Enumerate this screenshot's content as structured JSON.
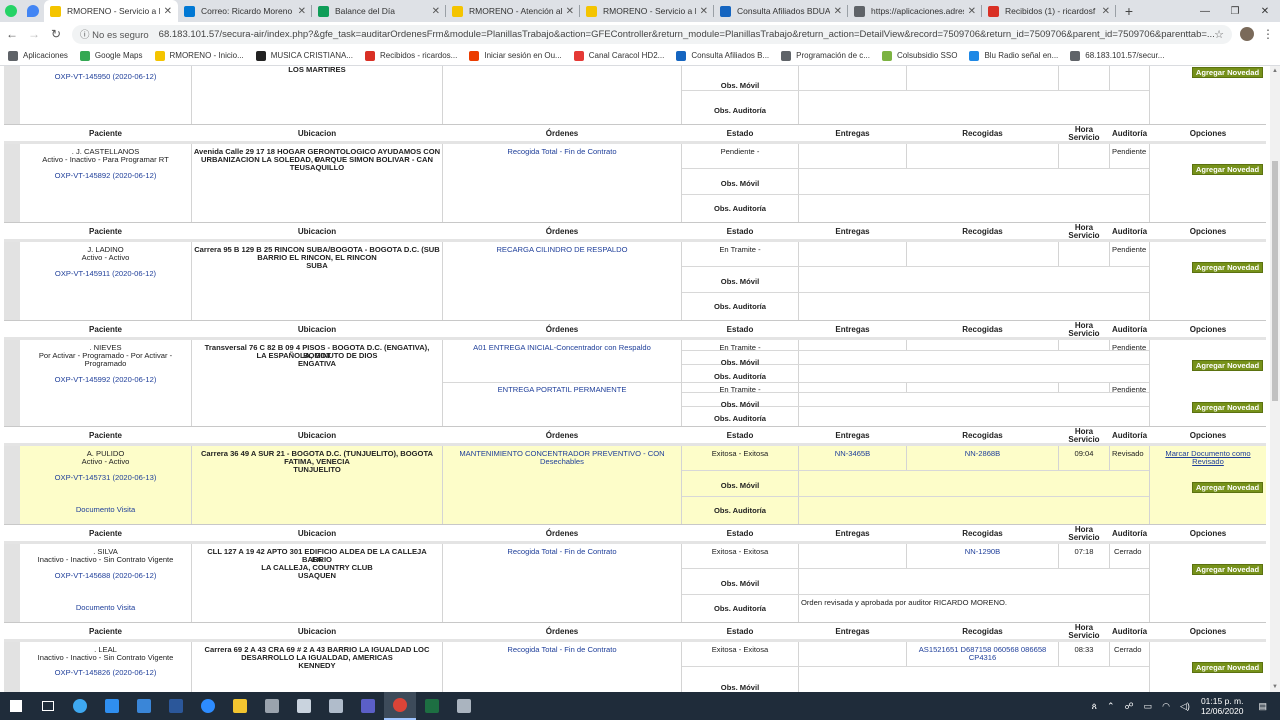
{
  "browser": {
    "pinned_tabs": [
      {
        "icon": "whatsapp-icon",
        "color": "#25d366"
      },
      {
        "icon": "maps-pin-icon",
        "color": "#4285f4"
      }
    ],
    "tabs": [
      {
        "title": "RMORENO - Servicio a D",
        "icon": "rmoreno-favicon",
        "color": "#f4c400",
        "active": true
      },
      {
        "title": "Correo: Ricardo Moreno",
        "icon": "outlook-favicon",
        "color": "#0078d4"
      },
      {
        "title": "Balance del Día",
        "icon": "sheets-favicon",
        "color": "#0f9d58"
      },
      {
        "title": "RMORENO - Atención al",
        "icon": "rmoreno-favicon",
        "color": "#f4c400"
      },
      {
        "title": "RMORENO - Servicio a D",
        "icon": "rmoreno-favicon",
        "color": "#f4c400"
      },
      {
        "title": "Consulta Afiliados BDUA",
        "icon": "triangle-favicon",
        "color": "#1565c0"
      },
      {
        "title": "https://aplicaciones.adres",
        "icon": "globe-favicon",
        "color": "#5f6368"
      },
      {
        "title": "Recibidos (1) - ricardosf",
        "icon": "gmail-favicon",
        "color": "#d93025"
      }
    ],
    "new_tab": "+",
    "window_controls": {
      "minimize": "—",
      "restore": "❐",
      "close": "✕"
    },
    "security_label": "No es seguro",
    "url": "68.183.101.57/secura-air/index.php?&gfe_task=auditarOrdenesFrm&module=PlanillasTrabajo&action=GFEController&return_module=PlanillasTrabajo&return_action=DetailView&record=7509706&return_id=7509706&parent_id=7509706&parenttab=...",
    "bookmarks": [
      {
        "label": "Aplicaciones",
        "icon": "apps-grid-icon",
        "color": "#5f6368"
      },
      {
        "label": "Google Maps",
        "icon": "maps-pin-icon",
        "color": "#34a853"
      },
      {
        "label": "RMORENO - Inicio...",
        "icon": "rmoreno-favicon",
        "color": "#f4c400"
      },
      {
        "label": "MUSICA CRISTIANA...",
        "icon": "music-favicon",
        "color": "#222222"
      },
      {
        "label": "Recibidos - ricardos...",
        "icon": "gmail-favicon",
        "color": "#d93025"
      },
      {
        "label": "Iniciar sesión en Ou...",
        "icon": "office-favicon",
        "color": "#eb3c00"
      },
      {
        "label": "Canal Caracol HD2...",
        "icon": "caracol-favicon",
        "color": "#e53935"
      },
      {
        "label": "Consulta Afiliados B...",
        "icon": "triangle-favicon",
        "color": "#1565c0"
      },
      {
        "label": "Programación de c...",
        "icon": "link-favicon",
        "color": "#5f6368"
      },
      {
        "label": "Colsubsidio SSO",
        "icon": "colsubsidio-favicon",
        "color": "#7cb342"
      },
      {
        "label": "Blu Radio señal en...",
        "icon": "blu-favicon",
        "color": "#1e88e5"
      },
      {
        "label": "68.183.101.57/secur...",
        "icon": "globe-favicon",
        "color": "#5f6368"
      }
    ]
  },
  "table": {
    "headers": {
      "paciente": "Paciente",
      "ubicacion": "Ubicacion",
      "ordenes": "Órdenes",
      "estado": "Estado",
      "entregas": "Entregas",
      "recogidas": "Recogidas",
      "hora_l1": "Hora",
      "hora_l2": "Servicio",
      "auditoria": "Auditoría",
      "opciones": "Opciones"
    },
    "labels": {
      "obs_movil": "Obs. Móvil",
      "obs_auditoria": "Obs. Auditoría",
      "agregar": "Agregar Novedad",
      "documento_visita": "Documento Visita",
      "marcar_l1": "Marcar Documento como",
      "marcar_l2": "Revisado"
    },
    "top": {
      "order_id": "OXP-VT-145950 (2020-06-12)",
      "ubic": "LOS MARTIRES"
    },
    "records": [
      {
        "name": ". J. CASTELLANOS",
        "status": "Activo - Inactivo - Para Programar RT",
        "order_id": "OXP-VT-145892 (2020-06-12)",
        "ubic1": "Avenida Calle 29 17 18 HOGAR GERONTOLOGICO AYUDAMOS CON C",
        "ubic2": "URBANIZACION LA SOLEDAD, PARQUE SIMON BOLIVAR - CAN",
        "ubic3": "TEUSAQUILLO",
        "orden": "Recogida Total - Fin de Contrato",
        "estado": "Pendiente -",
        "auditoria": "Pendiente"
      },
      {
        "name": "J. LADINO",
        "status": "Activo - Activo",
        "order_id": "OXP-VT-145911 (2020-06-12)",
        "ubic1": "Carrera 95 B 129 B 25 RINCON SUBA/BOGOTA - BOGOTA D.C. (SUB",
        "ubic2": "BARRIO EL RINCON, EL RINCON",
        "ubic3": "SUBA",
        "orden": "RECARGA CILINDRO DE RESPALDO",
        "estado": "En Tramite -",
        "auditoria": "Pendiente"
      },
      {
        "name": ". NIEVES",
        "status1": "Por Activar - Programado - Por Activar -",
        "status2": "Programado",
        "order_id": "OXP-VT-145992 (2020-06-12)",
        "ubic1": "Transversal 76 C 82 B 09 4 PISOS - BOGOTA D.C. (ENGATIVA), BOGOT",
        "ubic2": "LA ESPAÑOLA, MINUTO DE DIOS",
        "ubic3": "ENGATIVA",
        "orden_a": "A01 ENTREGA INICIAL-Concentrador con Respaldo",
        "estado_a": "En Tramite -",
        "auditoria_a": "Pendiente",
        "orden_b": "ENTREGA PORTATIL PERMANENTE",
        "estado_b": "En Tramite -",
        "auditoria_b": "Pendiente"
      },
      {
        "name": "A. PULIDO",
        "status": "Activo - Activo",
        "order_id": "OXP-VT-145731 (2020-06-13)",
        "ubic1": "Carrera 36 49 A SUR 21 - BOGOTA D.C. (TUNJUELITO), BOGOTA",
        "ubic2": "FATIMA, VENECIA",
        "ubic3": "TUNJUELITO",
        "orden1": "MANTENIMIENTO CONCENTRADOR PREVENTIVO - CON",
        "orden2": "Desechables",
        "estado": "Exitosa - Exitosa",
        "entregas": "NN-3465B",
        "recogidas": "NN-2868B",
        "hora": "09:04",
        "auditoria": "Revisado"
      },
      {
        "name": ". SILVA",
        "status": "Inactivo - Inactivo - Sin Contrato Vigente",
        "order_id": "OXP-VT-145688 (2020-06-12)",
        "ubic1": "CLL 127 A 19 42 APTO 301 EDIFICIO ALDEA DE LA CALLEJA BARRIO",
        "ubic2": "LA",
        "ubic3": "LA CALLEJA, COUNTRY CLUB",
        "ubic4": "USAQUEN",
        "orden": "Recogida Total - Fin de Contrato",
        "estado": "Exitosa - Exitosa",
        "recogidas": "NN-1290B",
        "hora": "07:18",
        "auditoria": "Cerrado",
        "obs_auditoria_text": "Orden revisada y aprobada por auditor RICARDO MORENO."
      },
      {
        "name": ". LEAL",
        "status": "Inactivo - Inactivo - Sin Contrato Vigente",
        "order_id": "OXP-VT-145826 (2020-06-12)",
        "ubic1": "Carrera 69 2 A 43 CRA 69 # 2 A 43 BARRIO LA IGUALDAD LOC",
        "ubic2": "DESARROLLO LA IGUALDAD, AMERICAS",
        "ubic3": "KENNEDY",
        "orden": "Recogida Total - Fin de Contrato",
        "estado": "Exitosa - Exitosa",
        "recogidas1": "AS1521651 D687158 060568 086658",
        "recogidas2": "CP4316",
        "hora": "08:33",
        "auditoria": "Cerrado"
      }
    ]
  },
  "taskbar": {
    "apps": [
      {
        "icon": "windows-start-icon",
        "color": "#ffffff"
      },
      {
        "icon": "task-view-icon",
        "color": "#ffffff"
      },
      {
        "icon": "edge-icon",
        "color": "#3ea8f0"
      },
      {
        "icon": "store-icon",
        "color": "#2f8ff0"
      },
      {
        "icon": "mail-icon",
        "color": "#3a86d8"
      },
      {
        "icon": "word-icon",
        "color": "#2b579a"
      },
      {
        "icon": "zoom-icon",
        "color": "#2d8cff"
      },
      {
        "icon": "file-explorer-icon",
        "color": "#f2c530"
      },
      {
        "icon": "app-arrow-icon",
        "color": "#9aa3ad"
      },
      {
        "icon": "app-wing-icon",
        "color": "#c9d3de"
      },
      {
        "icon": "app-person-icon",
        "color": "#b0bccb"
      },
      {
        "icon": "teams-icon",
        "color": "#5b5fc7"
      },
      {
        "icon": "chrome-icon",
        "color": "#db4437"
      },
      {
        "icon": "excel-icon",
        "color": "#1d6f42"
      },
      {
        "icon": "app-feather-icon",
        "color": "#aab4bf"
      }
    ],
    "time": "01:15 p. m.",
    "date": "12/06/2020"
  }
}
